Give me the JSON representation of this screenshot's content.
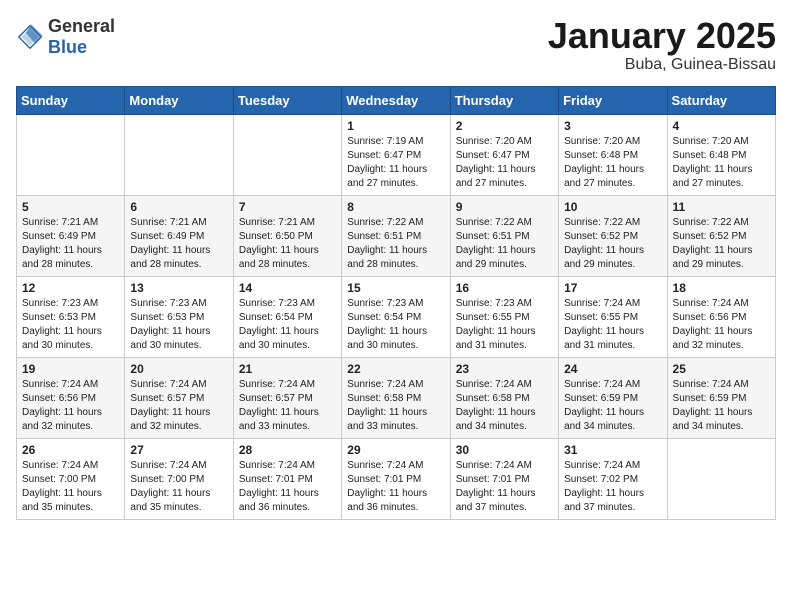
{
  "header": {
    "logo_general": "General",
    "logo_blue": "Blue",
    "month_title": "January 2025",
    "location": "Buba, Guinea-Bissau"
  },
  "weekdays": [
    "Sunday",
    "Monday",
    "Tuesday",
    "Wednesday",
    "Thursday",
    "Friday",
    "Saturday"
  ],
  "weeks": [
    [
      {
        "day": "",
        "info": ""
      },
      {
        "day": "",
        "info": ""
      },
      {
        "day": "",
        "info": ""
      },
      {
        "day": "1",
        "info": "Sunrise: 7:19 AM\nSunset: 6:47 PM\nDaylight: 11 hours\nand 27 minutes."
      },
      {
        "day": "2",
        "info": "Sunrise: 7:20 AM\nSunset: 6:47 PM\nDaylight: 11 hours\nand 27 minutes."
      },
      {
        "day": "3",
        "info": "Sunrise: 7:20 AM\nSunset: 6:48 PM\nDaylight: 11 hours\nand 27 minutes."
      },
      {
        "day": "4",
        "info": "Sunrise: 7:20 AM\nSunset: 6:48 PM\nDaylight: 11 hours\nand 27 minutes."
      }
    ],
    [
      {
        "day": "5",
        "info": "Sunrise: 7:21 AM\nSunset: 6:49 PM\nDaylight: 11 hours\nand 28 minutes."
      },
      {
        "day": "6",
        "info": "Sunrise: 7:21 AM\nSunset: 6:49 PM\nDaylight: 11 hours\nand 28 minutes."
      },
      {
        "day": "7",
        "info": "Sunrise: 7:21 AM\nSunset: 6:50 PM\nDaylight: 11 hours\nand 28 minutes."
      },
      {
        "day": "8",
        "info": "Sunrise: 7:22 AM\nSunset: 6:51 PM\nDaylight: 11 hours\nand 28 minutes."
      },
      {
        "day": "9",
        "info": "Sunrise: 7:22 AM\nSunset: 6:51 PM\nDaylight: 11 hours\nand 29 minutes."
      },
      {
        "day": "10",
        "info": "Sunrise: 7:22 AM\nSunset: 6:52 PM\nDaylight: 11 hours\nand 29 minutes."
      },
      {
        "day": "11",
        "info": "Sunrise: 7:22 AM\nSunset: 6:52 PM\nDaylight: 11 hours\nand 29 minutes."
      }
    ],
    [
      {
        "day": "12",
        "info": "Sunrise: 7:23 AM\nSunset: 6:53 PM\nDaylight: 11 hours\nand 30 minutes."
      },
      {
        "day": "13",
        "info": "Sunrise: 7:23 AM\nSunset: 6:53 PM\nDaylight: 11 hours\nand 30 minutes."
      },
      {
        "day": "14",
        "info": "Sunrise: 7:23 AM\nSunset: 6:54 PM\nDaylight: 11 hours\nand 30 minutes."
      },
      {
        "day": "15",
        "info": "Sunrise: 7:23 AM\nSunset: 6:54 PM\nDaylight: 11 hours\nand 30 minutes."
      },
      {
        "day": "16",
        "info": "Sunrise: 7:23 AM\nSunset: 6:55 PM\nDaylight: 11 hours\nand 31 minutes."
      },
      {
        "day": "17",
        "info": "Sunrise: 7:24 AM\nSunset: 6:55 PM\nDaylight: 11 hours\nand 31 minutes."
      },
      {
        "day": "18",
        "info": "Sunrise: 7:24 AM\nSunset: 6:56 PM\nDaylight: 11 hours\nand 32 minutes."
      }
    ],
    [
      {
        "day": "19",
        "info": "Sunrise: 7:24 AM\nSunset: 6:56 PM\nDaylight: 11 hours\nand 32 minutes."
      },
      {
        "day": "20",
        "info": "Sunrise: 7:24 AM\nSunset: 6:57 PM\nDaylight: 11 hours\nand 32 minutes."
      },
      {
        "day": "21",
        "info": "Sunrise: 7:24 AM\nSunset: 6:57 PM\nDaylight: 11 hours\nand 33 minutes."
      },
      {
        "day": "22",
        "info": "Sunrise: 7:24 AM\nSunset: 6:58 PM\nDaylight: 11 hours\nand 33 minutes."
      },
      {
        "day": "23",
        "info": "Sunrise: 7:24 AM\nSunset: 6:58 PM\nDaylight: 11 hours\nand 34 minutes."
      },
      {
        "day": "24",
        "info": "Sunrise: 7:24 AM\nSunset: 6:59 PM\nDaylight: 11 hours\nand 34 minutes."
      },
      {
        "day": "25",
        "info": "Sunrise: 7:24 AM\nSunset: 6:59 PM\nDaylight: 11 hours\nand 34 minutes."
      }
    ],
    [
      {
        "day": "26",
        "info": "Sunrise: 7:24 AM\nSunset: 7:00 PM\nDaylight: 11 hours\nand 35 minutes."
      },
      {
        "day": "27",
        "info": "Sunrise: 7:24 AM\nSunset: 7:00 PM\nDaylight: 11 hours\nand 35 minutes."
      },
      {
        "day": "28",
        "info": "Sunrise: 7:24 AM\nSunset: 7:01 PM\nDaylight: 11 hours\nand 36 minutes."
      },
      {
        "day": "29",
        "info": "Sunrise: 7:24 AM\nSunset: 7:01 PM\nDaylight: 11 hours\nand 36 minutes."
      },
      {
        "day": "30",
        "info": "Sunrise: 7:24 AM\nSunset: 7:01 PM\nDaylight: 11 hours\nand 37 minutes."
      },
      {
        "day": "31",
        "info": "Sunrise: 7:24 AM\nSunset: 7:02 PM\nDaylight: 11 hours\nand 37 minutes."
      },
      {
        "day": "",
        "info": ""
      }
    ]
  ]
}
